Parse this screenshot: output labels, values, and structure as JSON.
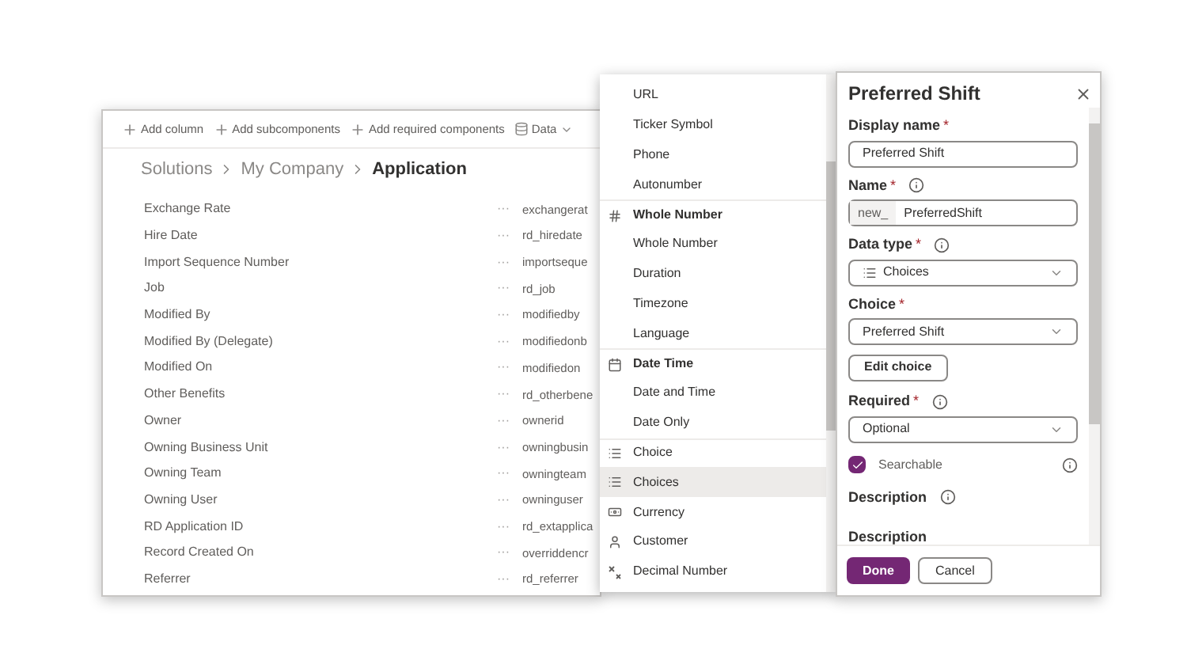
{
  "toolbar": [
    {
      "label": "Add column",
      "kind": "add"
    },
    {
      "label": "Add subcomponents",
      "kind": "add"
    },
    {
      "label": "Add required components",
      "kind": "add"
    },
    {
      "label": "Data",
      "kind": "data"
    }
  ],
  "breadcrumb": [
    {
      "label": "Solutions",
      "current": false
    },
    {
      "label": "My Company",
      "current": false
    },
    {
      "label": "Application",
      "current": true
    }
  ],
  "columns": [
    {
      "display": "Exchange Rate",
      "more": "···",
      "logical": "exchangerat"
    },
    {
      "display": "Hire Date",
      "more": "···",
      "logical": "rd_hiredate"
    },
    {
      "display": "Import Sequence Number",
      "more": "···",
      "logical": "importseque"
    },
    {
      "display": "Job",
      "more": "···",
      "logical": "rd_job"
    },
    {
      "display": "Modified By",
      "more": "···",
      "logical": "modifiedby"
    },
    {
      "display": "Modified By (Delegate)",
      "more": "···",
      "logical": "modifiedonb"
    },
    {
      "display": "Modified On",
      "more": "···",
      "logical": "modifiedon"
    },
    {
      "display": "Other Benefits",
      "more": "···",
      "logical": "rd_otherbene"
    },
    {
      "display": "Owner",
      "more": "···",
      "logical": "ownerid"
    },
    {
      "display": "Owning Business Unit",
      "more": "···",
      "logical": "owningbusin"
    },
    {
      "display": "Owning Team",
      "more": "···",
      "logical": "owningteam"
    },
    {
      "display": "Owning User",
      "more": "···",
      "logical": "owninguser"
    },
    {
      "display": "RD Application ID",
      "more": "···",
      "logical": "rd_extapplica"
    },
    {
      "display": "Record Created On",
      "more": "···",
      "logical": "overriddencr"
    },
    {
      "display": "Referrer",
      "more": "···",
      "logical": "rd_referrer"
    }
  ],
  "data_type_list": [
    {
      "label": "URL",
      "kind": "plain",
      "selected": false
    },
    {
      "label": "Ticker Symbol",
      "kind": "plain",
      "selected": false
    },
    {
      "label": "Phone",
      "kind": "plain",
      "selected": false
    },
    {
      "label": "Autonumber",
      "kind": "plain",
      "selected": false
    },
    {
      "label": "Whole Number",
      "kind": "numbers",
      "selected": false
    },
    {
      "label": "Whole Number",
      "kind": "plain",
      "selected": false
    },
    {
      "label": "Duration",
      "kind": "plain",
      "selected": false
    },
    {
      "label": "Timezone",
      "kind": "plain",
      "selected": false
    },
    {
      "label": "Language",
      "kind": "plain",
      "selected": false
    },
    {
      "label": "Date Time",
      "kind": "dates",
      "selected": false
    },
    {
      "label": "Date and Time",
      "kind": "plain",
      "selected": false
    },
    {
      "label": "Date Only",
      "kind": "plain",
      "selected": false
    },
    {
      "label": "Choice",
      "kind": "list",
      "selected": false
    },
    {
      "label": "Choices",
      "kind": "list",
      "selected": true
    },
    {
      "label": "Currency",
      "kind": "currency",
      "selected": false
    },
    {
      "label": "Customer",
      "kind": "person",
      "selected": false
    },
    {
      "label": "Decimal Number",
      "kind": "decimal",
      "selected": false
    }
  ],
  "panel": {
    "title": "Preferred Shift",
    "mandatory_mark": "*",
    "display_name": {
      "label": "Display name",
      "mandatory": true,
      "value": "Preferred Shift"
    },
    "name": {
      "label": "Name",
      "mandatory": true,
      "prefix": "new_",
      "value": "PreferredShift"
    },
    "data_type": {
      "label": "Data type",
      "mandatory": true,
      "value": "Choices"
    },
    "choice": {
      "label": "Choice",
      "mandatory": true,
      "value": "Preferred Shift"
    },
    "edit_choice": "Edit choice",
    "required": {
      "label": "Required",
      "mandatory": true,
      "value": "Optional"
    },
    "searchable": {
      "label": "Searchable",
      "checked": true
    },
    "description_heading": "Description",
    "description_label": "Description",
    "buttons": {
      "done": "Done",
      "cancel": "Cancel"
    }
  }
}
